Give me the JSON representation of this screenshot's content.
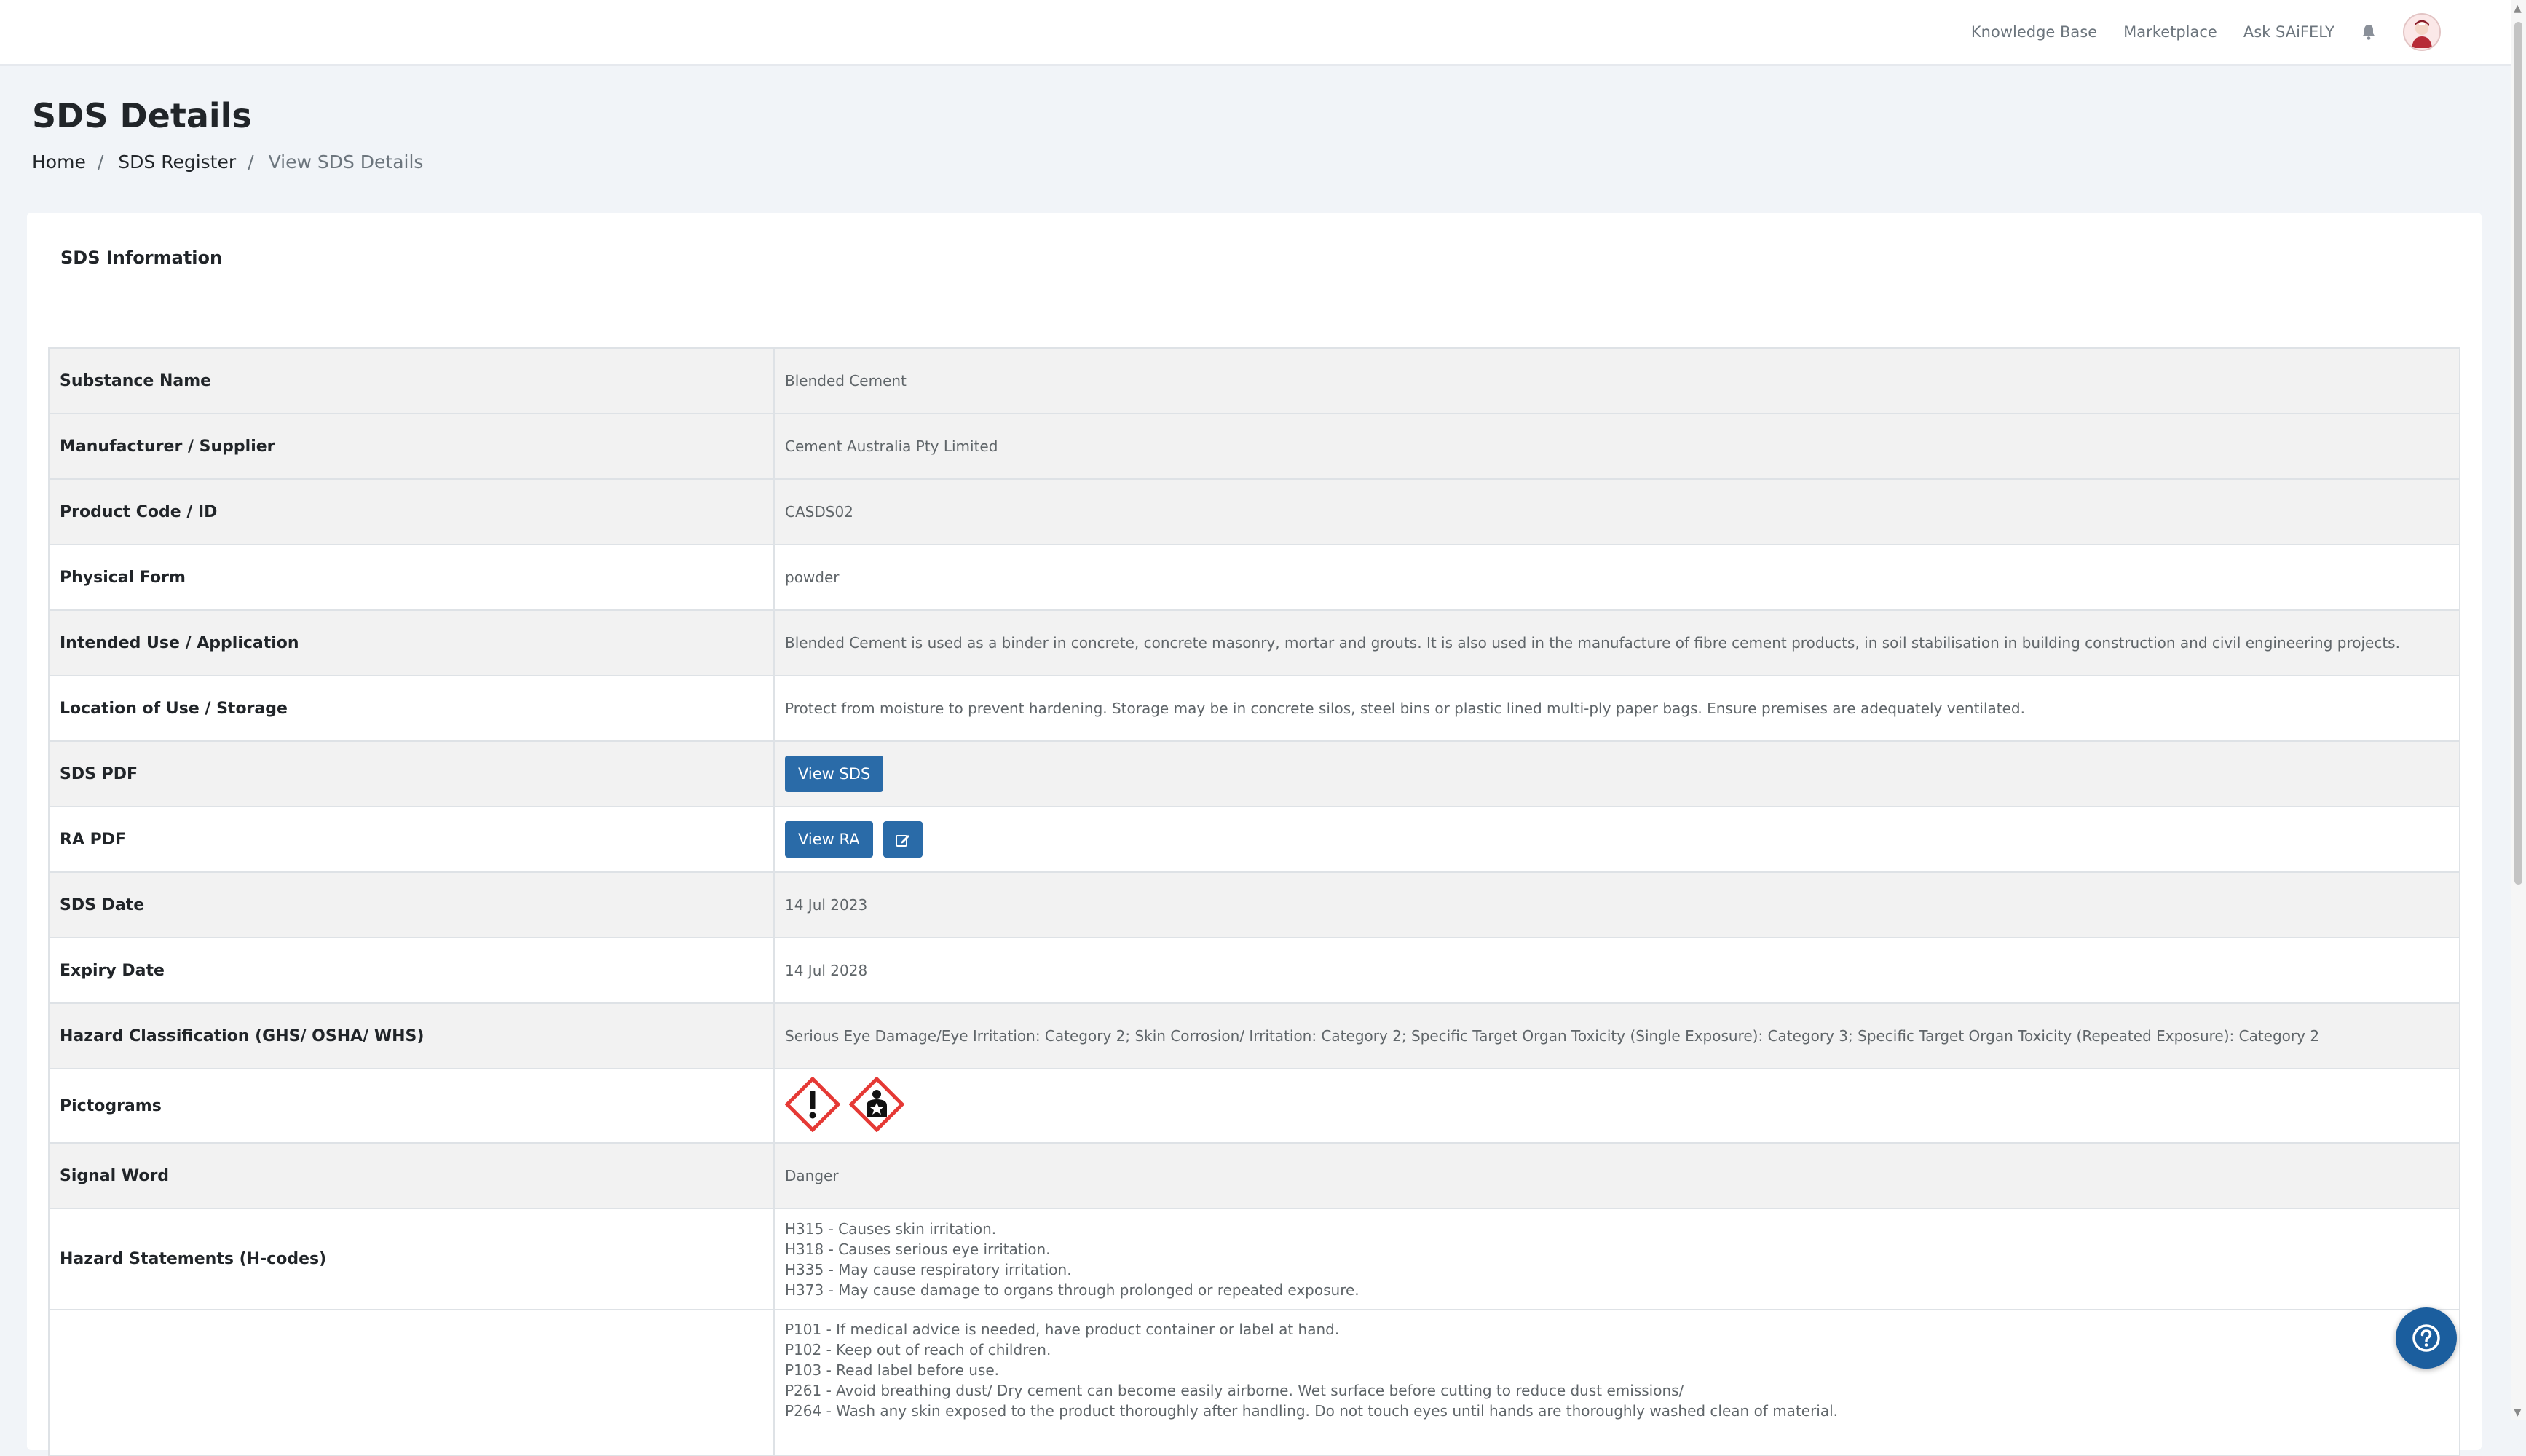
{
  "topnav": {
    "knowledge_base": "Knowledge Base",
    "marketplace": "Marketplace",
    "ask_saifely": "Ask SAiFELY"
  },
  "page": {
    "title": "SDS Details",
    "breadcrumb": {
      "home": "Home",
      "register": "SDS Register",
      "current": "View SDS Details"
    }
  },
  "card": {
    "title": "SDS Information"
  },
  "rows": {
    "substance_name": {
      "label": "Substance Name",
      "value": "Blended Cement"
    },
    "manufacturer": {
      "label": "Manufacturer / Supplier",
      "value": "Cement Australia Pty Limited"
    },
    "product_code": {
      "label": "Product Code / ID",
      "value": "CASDS02"
    },
    "physical_form": {
      "label": "Physical Form",
      "value": "powder"
    },
    "intended_use": {
      "label": "Intended Use / Application",
      "value": "Blended Cement is used as a binder in concrete, concrete masonry, mortar and grouts. It is also used in the manufacture of fibre cement products, in soil stabilisation in building construction and civil engineering projects."
    },
    "location": {
      "label": "Location of Use / Storage",
      "value": "Protect from moisture to prevent hardening. Storage may be in concrete silos, steel bins or plastic lined multi-ply paper bags. Ensure premises are adequately ventilated."
    },
    "sds_pdf": {
      "label": "SDS PDF",
      "button": "View SDS"
    },
    "ra_pdf": {
      "label": "RA PDF",
      "button": "View RA",
      "edit_icon": "edit-icon"
    },
    "sds_date": {
      "label": "SDS Date",
      "value": "14 Jul 2023"
    },
    "expiry_date": {
      "label": "Expiry Date",
      "value": "14 Jul 2028"
    },
    "hazard_classification": {
      "label": "Hazard Classification (GHS/ OSHA/ WHS)",
      "value": "Serious Eye Damage/Eye Irritation: Category 2; Skin Corrosion/ Irritation: Category 2; Specific Target Organ Toxicity (Single Exposure): Category 3; Specific Target Organ Toxicity (Repeated Exposure): Category 2"
    },
    "pictograms": {
      "label": "Pictograms",
      "icons": [
        "exclamation-mark-pictogram-icon",
        "health-hazard-pictogram-icon"
      ]
    },
    "signal_word": {
      "label": "Signal Word",
      "value": "Danger"
    },
    "hazard_statements": {
      "label": "Hazard Statements (H-codes)",
      "lines": [
        "H315 - Causes skin irritation.",
        "H318 - Causes serious eye irritation.",
        "H335 - May cause respiratory irritation.",
        "H373 - May cause damage to organs through prolonged or repeated exposure."
      ]
    },
    "precautionary_statements": {
      "label": "",
      "lines": [
        "P101 - If medical advice is needed, have product container or label at hand.",
        "P102 - Keep out of reach of children.",
        "P103 - Read label before use.",
        "P261 - Avoid breathing dust/ Dry cement can become easily airborne. Wet surface before cutting to reduce dust emissions/",
        "P264 - Wash any skin exposed to the product thoroughly after handling. Do not touch eyes until hands are thoroughly washed clean of material."
      ]
    }
  },
  "colors": {
    "primary": "#2a6ba8",
    "help": "#1b5e9e",
    "background": "#f1f4f8",
    "pictogram_border": "#e53935"
  },
  "icons": {
    "bell": "bell-icon",
    "avatar": "avatar",
    "help": "question-icon"
  }
}
